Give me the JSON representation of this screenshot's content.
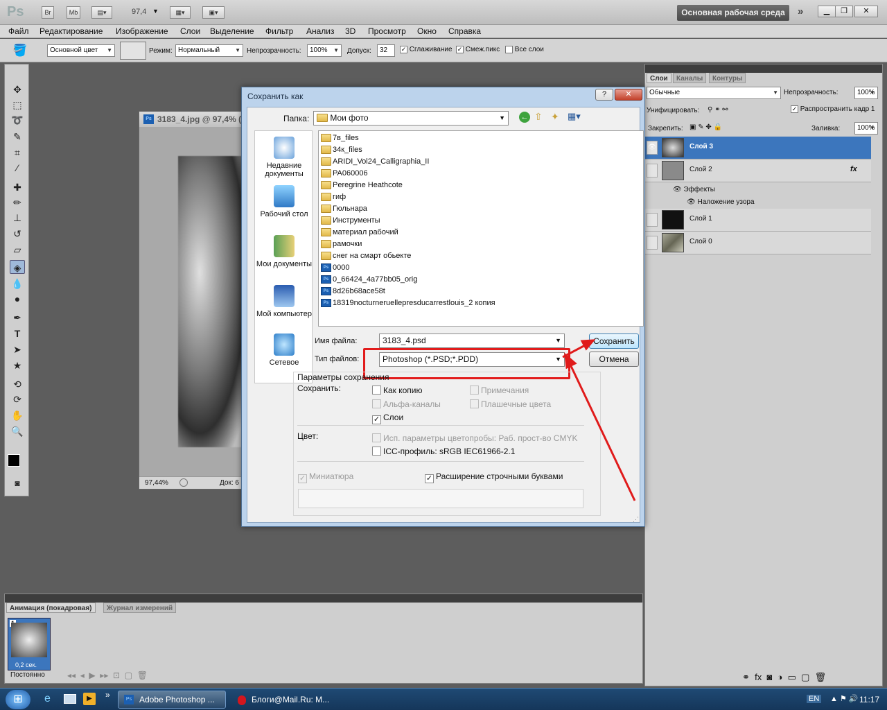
{
  "app": {
    "logo": "Ps",
    "bridge_label": "Br",
    "mini_bridge_label": "Mb",
    "zoom": "97,4",
    "workspace": "Основная рабочая среда"
  },
  "menu": [
    "Файл",
    "Редактирование",
    "Изображение",
    "Слои",
    "Выделение",
    "Фильтр",
    "Анализ",
    "3D",
    "Просмотр",
    "Окно",
    "Справка"
  ],
  "options": {
    "fill_source": "Основной цвет",
    "mode_label": "Режим:",
    "mode_value": "Нормальный",
    "opacity_label": "Непрозрачность:",
    "opacity_value": "100%",
    "tolerance_label": "Допуск:",
    "tolerance_value": "32",
    "antialias_label": "Сглаживание",
    "contiguous_label": "Смеж.пикс",
    "all_layers_label": "Все слои"
  },
  "document": {
    "title": "3183_4.jpg @ 97,4% (",
    "zoom_status": "97,44%",
    "doc_status": "Док: 6"
  },
  "layers_panel": {
    "tabs": [
      "Слои",
      "Каналы",
      "Контуры"
    ],
    "blend_mode": "Обычные",
    "opacity_label": "Непрозрачность:",
    "opacity_value": "100%",
    "unify_label": "Унифицировать:",
    "propagate_label": "Распространить кадр 1",
    "lock_label": "Закрепить:",
    "fill_label": "Заливка:",
    "fill_value": "100%",
    "layers": [
      "Слой 3",
      "Слой 2",
      "Слой 1",
      "Слой 0"
    ],
    "effects_label": "Эффекты",
    "effect_name": "Наложение узора",
    "fx_label": "fx"
  },
  "animation_panel": {
    "tabs": [
      "Анимация (покадровая)",
      "Журнал измерений"
    ],
    "frame_number": "1",
    "frame_delay": "0,2 сек.",
    "loop": "Постоянно"
  },
  "taskbar": {
    "items": [
      "Adobe Photoshop ...",
      "Блоги@Mail.Ru: M..."
    ],
    "lang": "EN",
    "time": "11:17"
  },
  "dialog": {
    "title": "Сохранить как",
    "folder_label": "Папка:",
    "folder_value": "Мои фото",
    "places": [
      "Недавние документы",
      "Рабочий стол",
      "Мои документы",
      "Мой компьютер",
      "Сетевое"
    ],
    "folders": [
      "7в_files",
      "34к_files",
      "ARIDI_Vol24_Calligraphia_II",
      "PA060006",
      "Peregrine Heathcote",
      "гиф",
      "Гюльнара",
      "Инструменты",
      "материал рабочий",
      "рамочки",
      "снег на смарт обьекте"
    ],
    "files": [
      "0000",
      "0_66424_4a77bb05_orig",
      "8d26b68ace58t",
      "18319nocturneruellepresducarrestlouis_2 копия"
    ],
    "filename_label": "Имя файла:",
    "filename_value": "3183_4.psd",
    "filetype_label": "Тип файлов:",
    "filetype_value": "Photoshop (*.PSD;*.PDD)",
    "save_button": "Сохранить",
    "cancel_button": "Отмена",
    "params_title": "Параметры сохранения",
    "save_label": "Сохранить:",
    "as_copy": "Как копию",
    "notes": "Примечания",
    "alpha": "Альфа-каналы",
    "spot": "Плашечные цвета",
    "layers": "Слои",
    "color_label": "Цвет:",
    "proof": "Исп. параметры цветопробы: Раб. прост-во CMYK",
    "icc": "ICC-профиль:  sRGB IEC61966-2.1",
    "thumbnail": "Миниатюра",
    "lowercase_ext": "Расширение строчными буквами"
  }
}
